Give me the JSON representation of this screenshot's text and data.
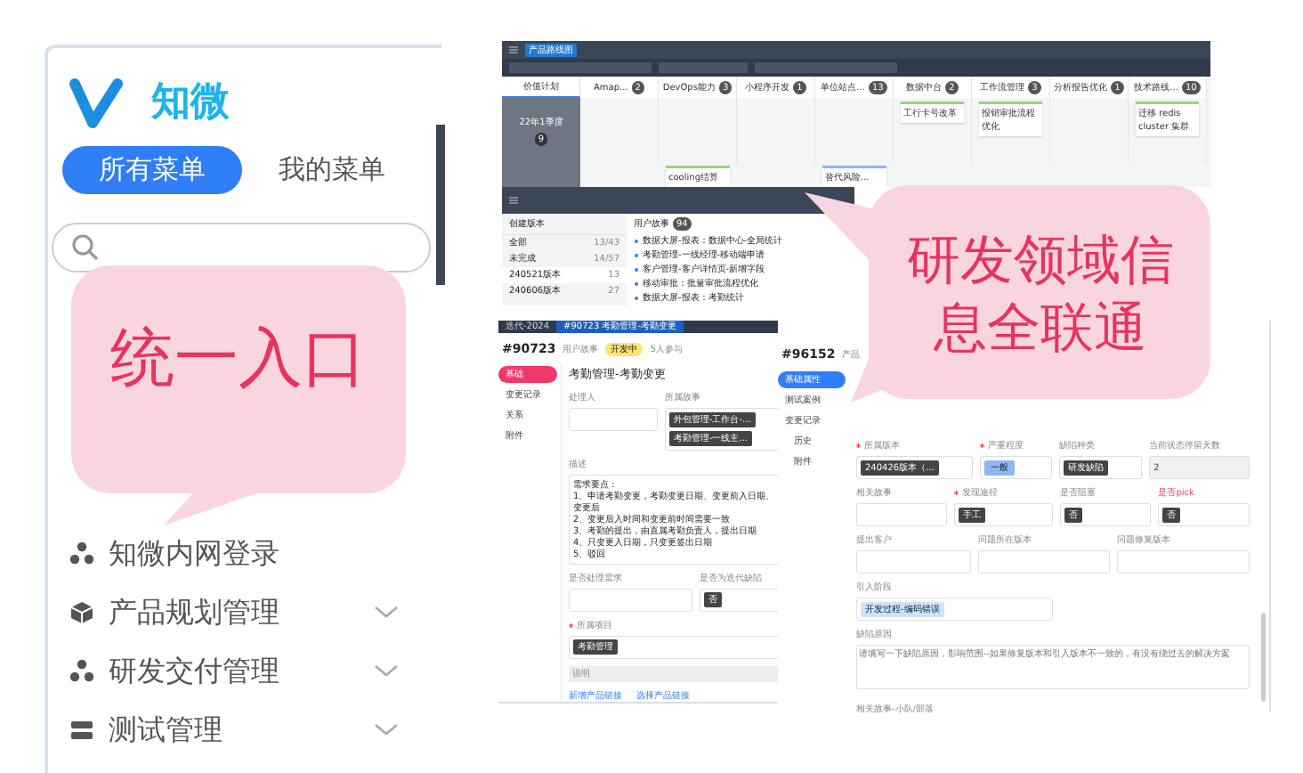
{
  "sidebar": {
    "logo": "知微",
    "tabs": [
      {
        "label": "所有菜单",
        "selected": true
      },
      {
        "label": "我的菜单",
        "selected": false
      }
    ],
    "items": [
      {
        "label": "知微内网登录",
        "has_submenu": false
      },
      {
        "label": "产品规划管理",
        "has_submenu": true
      },
      {
        "label": "研发交付管理",
        "has_submenu": true
      },
      {
        "label": "测试管理",
        "has_submenu": true
      }
    ]
  },
  "kanban": {
    "title": "产品路线图",
    "lane": {
      "label": "22年1季度",
      "count": "9"
    },
    "columns": [
      {
        "label": "价值计划",
        "selected": true
      },
      {
        "label": "Amap...",
        "count": "2",
        "selected": false
      },
      {
        "label": "DevOps能力",
        "count": "3",
        "selected": false,
        "cards_next": [
          {
            "text": "cooling结算",
            "color": "#9ad37a"
          }
        ]
      },
      {
        "label": "小程序开发",
        "count": "1",
        "selected": false
      },
      {
        "label": "单位站点...",
        "count": "13",
        "selected": false,
        "cards_next": [
          {
            "text": "替代风险...",
            "color": "#8fb6f0"
          }
        ]
      },
      {
        "label": "数据中台",
        "count": "2",
        "selected": false,
        "cards": [
          {
            "text": "工行卡号改革",
            "color": "#9ad37a"
          }
        ]
      },
      {
        "label": "工作流管理",
        "count": "3",
        "selected": false,
        "cards": [
          {
            "text": "报销审批流程优化",
            "color": "#9ad37a"
          }
        ]
      },
      {
        "label": "分析报告优化",
        "count": "1",
        "selected": false
      },
      {
        "label": "技术路线...",
        "count": "10",
        "selected": false,
        "cards": [
          {
            "text": "迁移 redis cluster 集群",
            "color": "#9ad37a"
          }
        ]
      }
    ]
  },
  "versions": {
    "create": "创建版本",
    "filters": [
      {
        "label": "全部",
        "count": "13/43",
        "selected": false
      },
      {
        "label": "未完成",
        "count": "14/57",
        "selected": false
      },
      {
        "label": "240521版本",
        "count": "13",
        "selected": true
      },
      {
        "label": "240606版本",
        "count": "27",
        "selected": false
      }
    ],
    "list_title": "用户故事",
    "list_count": "94",
    "stories": [
      "数据大屏-报表：数据中心-全局统计",
      "考勤管理-一线经理-移动端申请",
      "客户管理-客户详情页-新增字段",
      "移动审批：批量审批流程优化",
      "数据大屏-报表：考勤统计"
    ]
  },
  "tabbar": {
    "tabs": [
      {
        "label": "迭代-2024",
        "selected": false
      },
      {
        "label": "#90723 考勤管理-考勤变更",
        "selected": true
      }
    ]
  },
  "story": {
    "id": "#90723",
    "type": "用户故事",
    "status": "开发中",
    "members": "5人参与",
    "nav": [
      {
        "label": "基础",
        "selected": true
      },
      {
        "label": "变更记录",
        "selected": false
      },
      {
        "label": "关系",
        "selected": false
      },
      {
        "label": "附件",
        "selected": false
      }
    ],
    "title": "考勤管理-考勤变更",
    "owner_label": "处理人",
    "story_label": "所属故事",
    "story_tags": [
      "外包管理-工作台-...",
      "考勤管理-一线主..."
    ],
    "desc_label": "描述",
    "desc": [
      "需求要点：",
      "1、申请考勤变更，考勤变更日期、变更前入日期、变更后",
      "2、变更后入时间和变更前时间需要一致",
      "3、考勤的提出，由直属考勤负责人，提出日期",
      "4、只变更入日期，只变更签出日期",
      "5、驳回"
    ],
    "field1_label": "是否处理需求",
    "field2_label": "是否为迭代缺陷",
    "field2_value": "否",
    "project_label": "所属项目",
    "project_required": true,
    "project_tag": "考勤管理",
    "note_label": "说明",
    "links": [
      "新增产品链接",
      "选择产品链接"
    ]
  },
  "defect": {
    "id": "#96152",
    "type": "产品",
    "nav": [
      {
        "label": "基础属性",
        "selected": true
      },
      {
        "label": "测试案例",
        "selected": false
      },
      {
        "label": "变更记录",
        "selected": false
      },
      {
        "label": "历史",
        "selected": false
      },
      {
        "label": "附件",
        "selected": false
      }
    ],
    "rows": [
      [
        {
          "label": "所属版本",
          "required": true,
          "highlight": false,
          "kind": "tag",
          "value": "240426版本（..."
        },
        {
          "label": "严重程度",
          "required": true,
          "highlight": false,
          "kind": "soft",
          "value": "一般"
        },
        {
          "label": "缺陷种类",
          "required": false,
          "highlight": false,
          "kind": "tag",
          "value": "研发缺陷"
        },
        {
          "label": "当前状态停留天数",
          "required": false,
          "highlight": false,
          "kind": "readonly",
          "value": "2"
        }
      ],
      [
        {
          "label": "相关故事",
          "required": false,
          "highlight": false,
          "kind": "empty"
        },
        {
          "label": "发现途径",
          "required": true,
          "highlight": false,
          "kind": "tag",
          "value": "手工"
        },
        {
          "label": "是否阻塞",
          "required": false,
          "highlight": false,
          "kind": "tag",
          "value": "否"
        },
        {
          "label": "是否pick",
          "required": false,
          "highlight": true,
          "kind": "tag",
          "value": "否"
        }
      ],
      [
        {
          "label": "提出客户",
          "required": false,
          "highlight": false,
          "kind": "empty"
        },
        {
          "label": "问题所在版本",
          "required": false,
          "highlight": false,
          "kind": "empty"
        },
        {
          "label": "问题修复版本",
          "required": false,
          "highlight": false,
          "kind": "empty"
        }
      ]
    ],
    "stage_label": "引入阶段",
    "stage_tag": "开发过程-编码错误",
    "reason_label": "缺陷原因",
    "reason_placeholder": "请填写一下缺陷原因，影响范围--如果修复版本和引入版本不一致的，有没有绕过去的解决方案",
    "team_label": "相关故事-小队/部落"
  },
  "callouts": [
    {
      "text": "统一入口"
    },
    {
      "text": "研发领域信息全联通"
    }
  ]
}
